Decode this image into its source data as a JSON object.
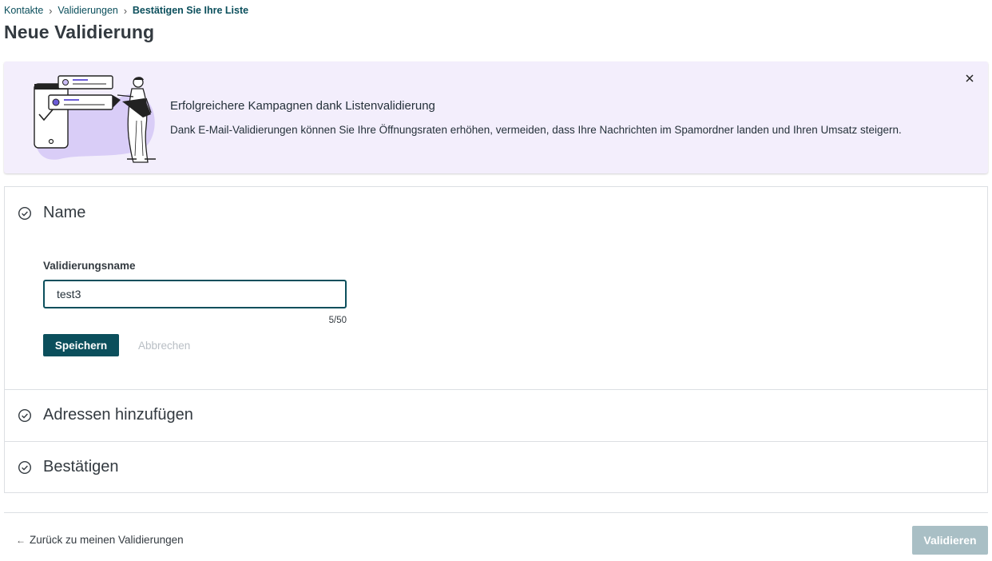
{
  "breadcrumb": {
    "items": [
      {
        "label": "Kontakte"
      },
      {
        "label": "Validierungen"
      }
    ],
    "current": "Bestätigen Sie Ihre Liste"
  },
  "page": {
    "title": "Neue Validierung"
  },
  "banner": {
    "title": "Erfolgreichere Kampagnen dank Listenvalidierung",
    "text": "Dank E-Mail-Validierungen können Sie Ihre Öffnungsraten erhöhen, vermeiden, dass Ihre Nachrichten im Spamordner landen und Ihren Umsatz steigern.",
    "close_icon": "close-icon",
    "background_color": "#f3eefc"
  },
  "steps": {
    "name": {
      "title": "Name",
      "field_label": "Validierungsname",
      "value": "test3",
      "counter": "5/50",
      "save_label": "Speichern",
      "cancel_label": "Abbrechen"
    },
    "addresses": {
      "title": "Adressen hinzufügen"
    },
    "confirm": {
      "title": "Bestätigen"
    },
    "icon": "check-circle-icon"
  },
  "footer": {
    "back_label": "Zurück zu meinen Validierungen",
    "validate_label": "Validieren"
  },
  "colors": {
    "primary": "#0b4f5c",
    "disabled_button": "#a9bfc5",
    "border": "#dcdfe3"
  }
}
